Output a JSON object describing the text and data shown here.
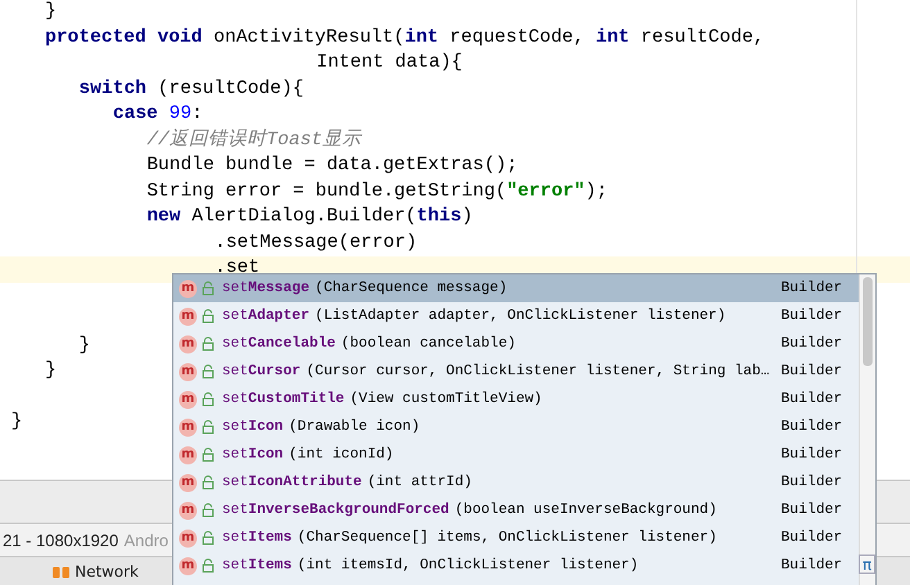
{
  "editor": {
    "lines": [
      {
        "kind": "code",
        "current": false,
        "tokens": [
          {
            "text": "    }",
            "kind": "plain"
          }
        ]
      },
      {
        "kind": "code",
        "current": false,
        "tokens": [
          {
            "text": "    protected void",
            "kind": "keyword"
          },
          {
            "text": " onActivityResult(",
            "kind": "plain"
          },
          {
            "text": "int",
            "kind": "keyword"
          },
          {
            "text": " requestCode, ",
            "kind": "plain"
          },
          {
            "text": "int",
            "kind": "keyword"
          },
          {
            "text": " resultCode,",
            "kind": "plain"
          }
        ]
      },
      {
        "kind": "code",
        "current": false,
        "tokens": [
          {
            "text": "                                    Intent data){",
            "kind": "plain"
          }
        ]
      },
      {
        "kind": "code",
        "current": false,
        "tokens": [
          {
            "text": "        switch",
            "kind": "keyword"
          },
          {
            "text": " (resultCode){",
            "kind": "plain"
          }
        ]
      },
      {
        "kind": "code",
        "current": false,
        "tokens": [
          {
            "text": "            case",
            "kind": "keyword"
          },
          {
            "text": " 99",
            "kind": "number"
          },
          {
            "text": ":",
            "kind": "plain"
          }
        ]
      },
      {
        "kind": "code",
        "current": false,
        "tokens": [
          {
            "text": "                //返回错误时Toast显示",
            "kind": "comment"
          }
        ]
      },
      {
        "kind": "code",
        "current": false,
        "tokens": [
          {
            "text": "                Bundle bundle = data.getExtras();",
            "kind": "plain"
          }
        ]
      },
      {
        "kind": "code",
        "current": false,
        "tokens": [
          {
            "text": "                String error = bundle.getString(",
            "kind": "plain"
          },
          {
            "text": "\"error\"",
            "kind": "string"
          },
          {
            "text": ");",
            "kind": "plain"
          }
        ]
      },
      {
        "kind": "code",
        "current": false,
        "tokens": [
          {
            "text": "                new",
            "kind": "keyword"
          },
          {
            "text": " AlertDialog.Builder(",
            "kind": "plain"
          },
          {
            "text": "this",
            "kind": "keyword"
          },
          {
            "text": ")",
            "kind": "plain"
          }
        ]
      },
      {
        "kind": "code",
        "current": false,
        "tokens": [
          {
            "text": "                        .setMessage(error)",
            "kind": "plain"
          }
        ]
      },
      {
        "kind": "code",
        "current": true,
        "tokens": [
          {
            "text": "                        .set",
            "kind": "plain"
          }
        ]
      },
      {
        "kind": "blank"
      },
      {
        "kind": "blank"
      },
      {
        "kind": "code",
        "current": false,
        "tokens": [
          {
            "text": "        }",
            "kind": "plain"
          }
        ]
      },
      {
        "kind": "code",
        "current": false,
        "tokens": [
          {
            "text": "    }",
            "kind": "plain"
          }
        ]
      },
      {
        "kind": "blank"
      },
      {
        "kind": "code",
        "current": false,
        "tokens": [
          {
            "text": "}",
            "kind": "plain"
          }
        ]
      }
    ]
  },
  "device_bar": {
    "device": "21 - 1080x1920",
    "platform": "Andro"
  },
  "tool_tabs": [
    {
      "label": "Network"
    }
  ],
  "completion": {
    "items": [
      {
        "badge": "m",
        "name": "set**Message**",
        "params": "(CharSequence message)",
        "type": "Builder",
        "selected": true
      },
      {
        "badge": "m",
        "name": "set**Adapter**",
        "params": "(ListAdapter adapter, OnClickListener listener)",
        "type": "Builder",
        "selected": false
      },
      {
        "badge": "m",
        "name": "set**Cancelable**",
        "params": "(boolean cancelable)",
        "type": "Builder",
        "selected": false
      },
      {
        "badge": "m",
        "name": "set**Cursor**",
        "params": "(Cursor cursor, OnClickListener listener, String lab…",
        "type": "Builder",
        "selected": false
      },
      {
        "badge": "m",
        "name": "set**CustomTitle**",
        "params": "(View customTitleView)",
        "type": "Builder",
        "selected": false
      },
      {
        "badge": "m",
        "name": "set**Icon**",
        "params": "(Drawable icon)",
        "type": "Builder",
        "selected": false
      },
      {
        "badge": "m",
        "name": "set**Icon**",
        "params": "(int iconId)",
        "type": "Builder",
        "selected": false
      },
      {
        "badge": "m",
        "name": "set**IconAttribute**",
        "params": "(int attrId)",
        "type": "Builder",
        "selected": false
      },
      {
        "badge": "m",
        "name": "set**InverseBackgroundForced**",
        "params": "(boolean useInverseBackground)",
        "type": "Builder",
        "selected": false
      },
      {
        "badge": "m",
        "name": "set**Items**",
        "params": "(CharSequence[] items, OnClickListener listener)",
        "type": "Builder",
        "selected": false
      },
      {
        "badge": "m",
        "name": "set**Items**",
        "params": "(int itemsId, OnClickListener listener)",
        "type": "Builder",
        "selected": false
      }
    ],
    "corner_button": "π"
  }
}
